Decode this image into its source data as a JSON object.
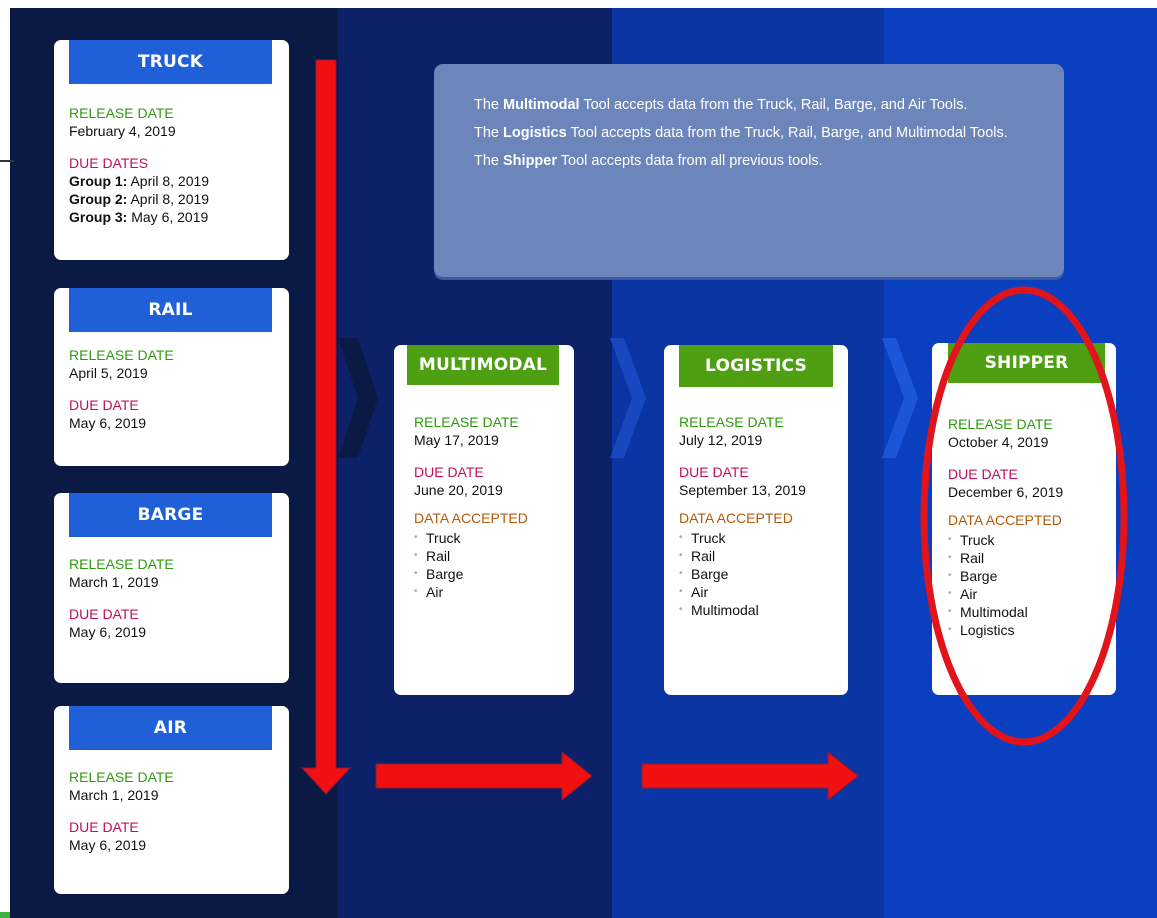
{
  "info": {
    "line1": [
      "The ",
      "Multimodal",
      " Tool accepts data from the Truck, Rail, Barge, and Air Tools."
    ],
    "line2": [
      "The ",
      "Logistics",
      " Tool accepts data from the Truck, Rail, Barge, and Multimodal Tools."
    ],
    "line3": [
      "The ",
      "Shipper",
      " Tool accepts data from all previous tools."
    ]
  },
  "labels": {
    "release_date": "RELEASE DATE",
    "due_dates": "DUE DATES",
    "due_date": "DUE DATE",
    "data_accepted": "DATA ACCEPTED"
  },
  "truck": {
    "title": "TRUCK",
    "release": "February 4, 2019",
    "groups": [
      {
        "name": "Group 1:",
        "date": " April 8, 2019"
      },
      {
        "name": "Group 2:",
        "date": " April 8, 2019"
      },
      {
        "name": "Group 3:",
        "date": " May 6, 2019"
      }
    ]
  },
  "rail": {
    "title": "RAIL",
    "release": "April 5, 2019",
    "due": "May 6, 2019"
  },
  "barge": {
    "title": "BARGE",
    "release": "March 1, 2019",
    "due": "May 6, 2019"
  },
  "air": {
    "title": "AIR",
    "release": "March 1, 2019",
    "due": "May 6, 2019"
  },
  "multimodal": {
    "title": "MULTIMODAL",
    "release": "May 17, 2019",
    "due": "June 20, 2019",
    "accepted": [
      "Truck",
      "Rail",
      "Barge",
      "Air"
    ]
  },
  "logistics": {
    "title": "LOGISTICS",
    "release": "July 12, 2019",
    "due": "September 13, 2019",
    "accepted": [
      "Truck",
      "Rail",
      "Barge",
      "Air",
      "Multimodal"
    ]
  },
  "shipper": {
    "title": "SHIPPER",
    "release": "October 4, 2019",
    "due": "December 6, 2019",
    "accepted": [
      "Truck",
      "Rail",
      "Barge",
      "Air",
      "Multimodal",
      "Logistics"
    ]
  },
  "colors": {
    "arrow_red": "#f20f0f",
    "circle_red": "#e0141a",
    "header_blue": "#1f5fd8",
    "header_green": "#4f9f12"
  }
}
